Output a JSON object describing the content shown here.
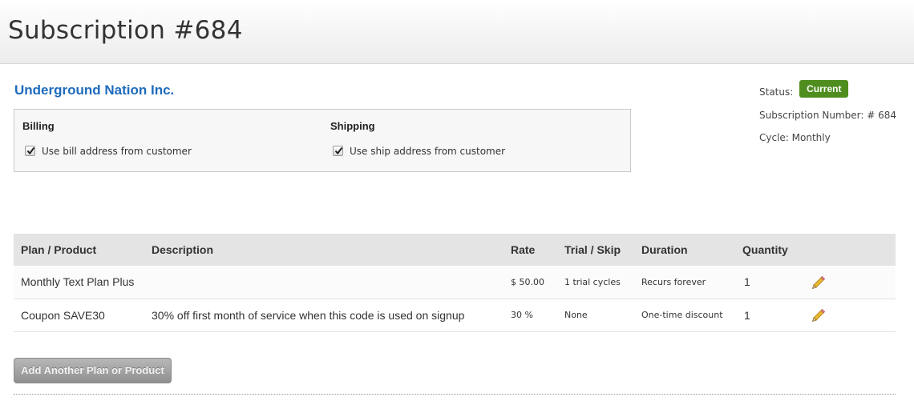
{
  "header": {
    "title": "Subscription #684"
  },
  "customer": {
    "name": "Underground Nation Inc."
  },
  "billing": {
    "heading": "Billing",
    "checkbox_label": "Use bill address from customer",
    "checked": true
  },
  "shipping": {
    "heading": "Shipping",
    "checkbox_label": "Use ship address from customer",
    "checked": true
  },
  "status_panel": {
    "status_label": "Status:",
    "status_value": "Current",
    "status_color": "#4e8d1e",
    "subscription_number": "Subscription Number: # 684",
    "cycle": "Cycle: Monthly"
  },
  "table": {
    "columns": [
      "Plan / Product",
      "Description",
      "Rate",
      "Trial / Skip",
      "Duration",
      "Quantity",
      ""
    ],
    "rows": [
      {
        "plan": "Monthly Text Plan Plus",
        "description": "",
        "rate": "$ 50.00",
        "trial": "1 trial cycles",
        "duration": "Recurs forever",
        "quantity": "1",
        "edit_icon": "pencil-icon"
      },
      {
        "plan": "Coupon SAVE30",
        "description": "30% off first month of service when this code is used on signup",
        "rate": "30 %",
        "trial": "None",
        "duration": "One-time discount",
        "quantity": "1",
        "edit_icon": "pencil-icon"
      }
    ]
  },
  "actions": {
    "add_label": "Add Another Plan or Product"
  },
  "colors": {
    "link_blue": "#1f6bbd",
    "header_bg": "#f0f0f0",
    "table_header_bg": "#e4e4e4"
  }
}
